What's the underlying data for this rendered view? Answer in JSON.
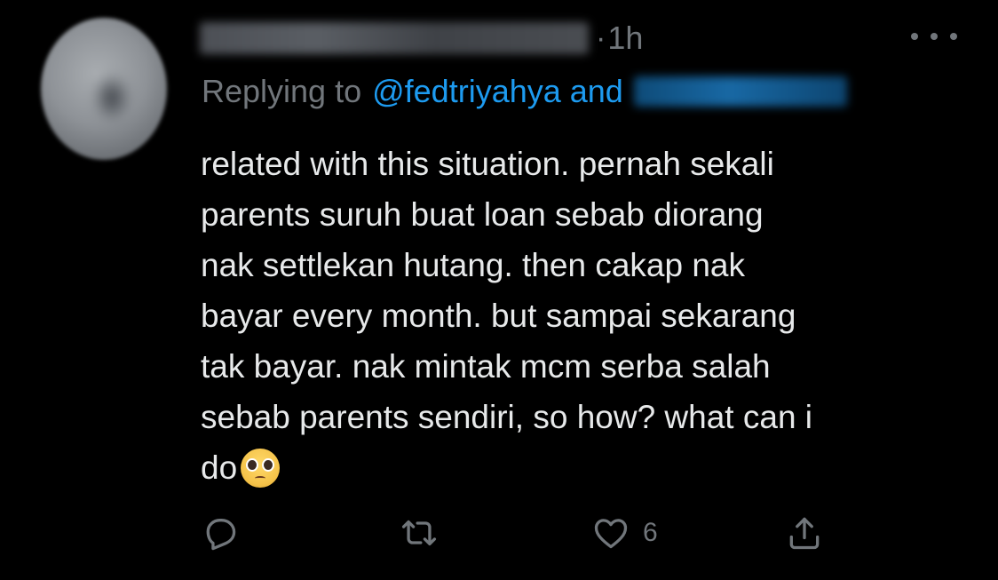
{
  "tweet": {
    "time": "1h",
    "separator": "·",
    "reply": {
      "prefix": "Replying to",
      "handle": "@fedtriyahya",
      "and": "and"
    },
    "body_lines": [
      "related with this situation. pernah sekali",
      "parents suruh buat loan sebab diorang",
      "nak settlekan hutang. then cakap nak",
      "bayar every month. but sampai sekarang",
      "tak bayar. nak mintak mcm serba salah",
      "sebab parents sendiri, so how? what can i",
      "do"
    ],
    "emoji": "pleading-face",
    "actions": {
      "reply_icon": "reply-icon",
      "retweet_icon": "retweet-icon",
      "like_icon": "heart-icon",
      "like_count": "6",
      "share_icon": "share-icon"
    }
  },
  "colors": {
    "background": "#000000",
    "text": "#e7e9ea",
    "secondary": "#71767b",
    "link": "#1d9bf0"
  }
}
